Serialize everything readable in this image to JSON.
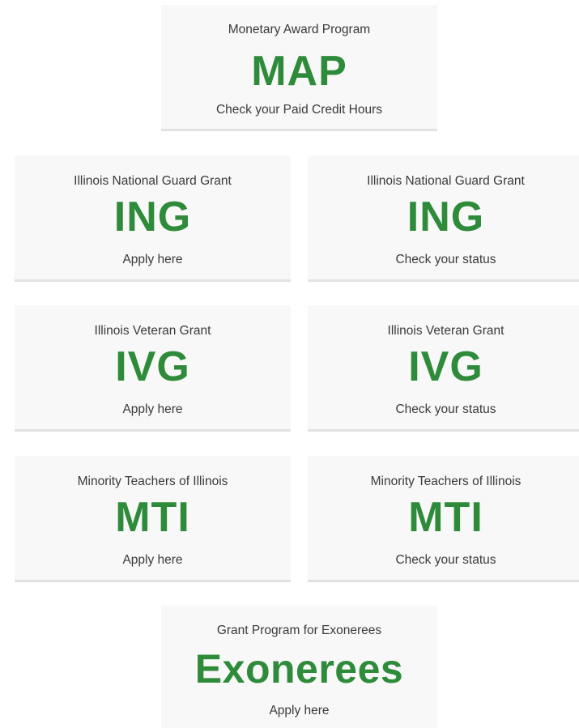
{
  "colors": {
    "accent_green": "#2e8b3a",
    "card_background": "#f8f8f8",
    "text_dark": "#3a3a3a"
  },
  "cards": [
    {
      "id": "map",
      "program_name": "Monetary Award Program",
      "acronym": "MAP",
      "action": "Check your Paid Credit Hours"
    },
    {
      "id": "ing-apply",
      "program_name": "Illinois National Guard Grant",
      "acronym": "ING",
      "action": "Apply here"
    },
    {
      "id": "ing-status",
      "program_name": "Illinois National Guard Grant",
      "acronym": "ING",
      "action": "Check your status"
    },
    {
      "id": "ivg-apply",
      "program_name": "Illinois Veteran Grant",
      "acronym": "IVG",
      "action": "Apply here"
    },
    {
      "id": "ivg-status",
      "program_name": "Illinois Veteran Grant",
      "acronym": "IVG",
      "action": "Check your status"
    },
    {
      "id": "mti-apply",
      "program_name": "Minority Teachers of Illinois",
      "acronym": "MTI",
      "action": "Apply here"
    },
    {
      "id": "mti-status",
      "program_name": "Minority Teachers of Illinois",
      "acronym": "MTI",
      "action": "Check your status"
    },
    {
      "id": "exonerees",
      "program_name": "Grant Program for Exonerees",
      "acronym": "Exonerees",
      "action": "Apply here"
    }
  ]
}
